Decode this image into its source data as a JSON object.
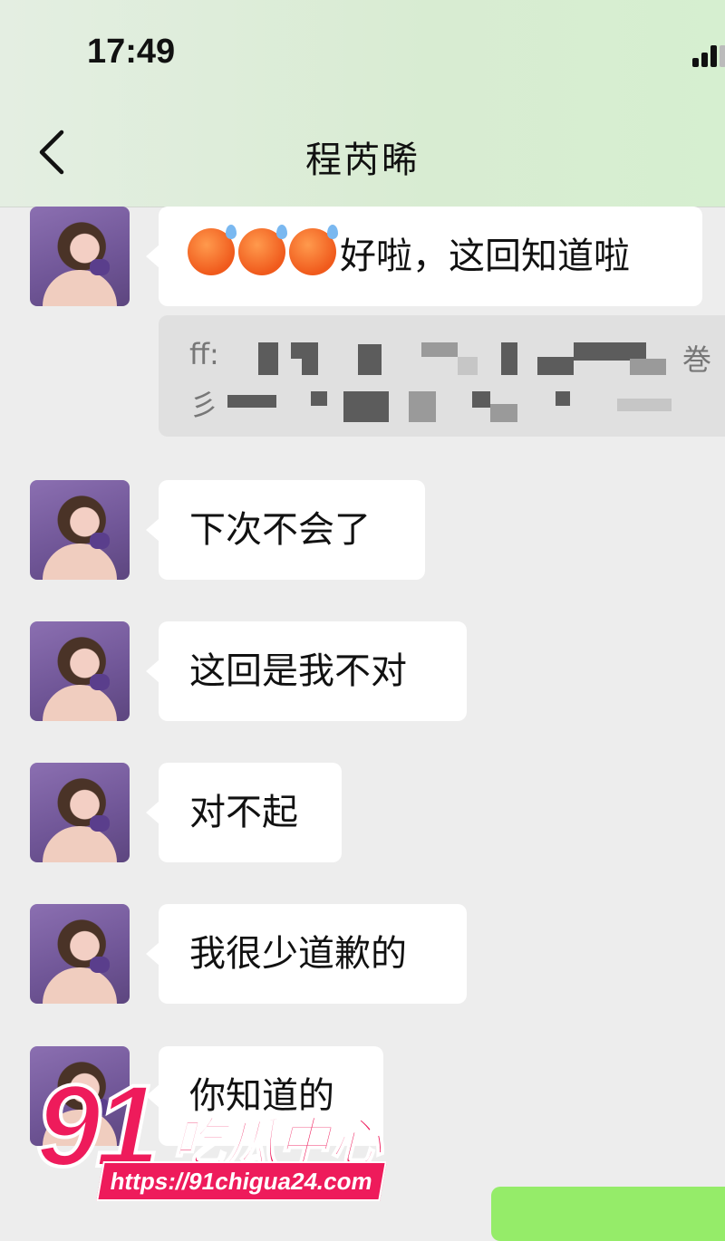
{
  "status_bar": {
    "time": "17:49"
  },
  "header": {
    "title": "程芮晞"
  },
  "messages": [
    {
      "text": "好啦，这回知道啦",
      "emoji_count": 3,
      "emoji": "sweating-face-emoji"
    },
    {
      "text": "下次不会了"
    },
    {
      "text": "这回是我不对"
    },
    {
      "text": "对不起"
    },
    {
      "text": "我很少道歉的"
    },
    {
      "text": "你知道的"
    }
  ],
  "quote": {
    "line1_prefix": "ff:",
    "line1_suffix": "巻",
    "line2_prefix": "彡"
  },
  "watermark": {
    "number": "91",
    "name": "吃瓜中心",
    "url": "https://91chigua24.com"
  },
  "colors": {
    "incoming_bubble": "#ffffff",
    "outgoing_bubble": "#95ec69",
    "watermark": "#ee1b5b",
    "background": "#ededed"
  }
}
